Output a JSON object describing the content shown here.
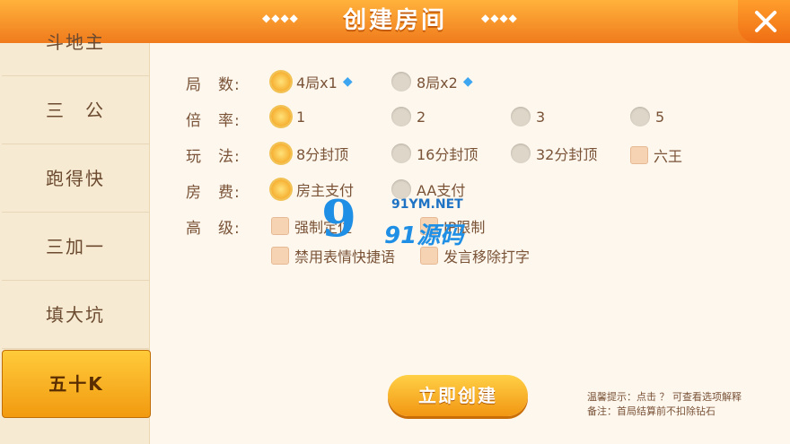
{
  "header": {
    "title": "创建房间",
    "deco": "◆◆◆◆"
  },
  "sidebar": {
    "items": [
      {
        "label": "斗地主"
      },
      {
        "label": "三　公"
      },
      {
        "label": "跑得快"
      },
      {
        "label": "三加一"
      },
      {
        "label": "填大坑"
      },
      {
        "label": "五十K"
      }
    ],
    "active": "五十K"
  },
  "rows": [
    {
      "label": "局　数:",
      "options": [
        {
          "text": "4局x1",
          "checked": true,
          "diamond": true
        },
        {
          "text": "8局x2",
          "checked": false,
          "diamond": true
        }
      ]
    },
    {
      "label": "倍　率:",
      "options": [
        {
          "text": "1",
          "checked": true
        },
        {
          "text": "2",
          "checked": false
        },
        {
          "text": "3",
          "checked": false
        },
        {
          "text": "5",
          "checked": false
        }
      ]
    },
    {
      "label": "玩　法:",
      "options": [
        {
          "text": "8分封顶",
          "checked": true
        },
        {
          "text": "16分封顶",
          "checked": false
        },
        {
          "text": "32分封顶",
          "checked": false
        },
        {
          "text": "六王",
          "checked": false
        }
      ]
    },
    {
      "label": "房　费:",
      "options": [
        {
          "text": "房主支付",
          "checked": true
        },
        {
          "text": "AA支付",
          "checked": false
        }
      ]
    },
    {
      "label": "高　级:",
      "options": [
        {
          "text": "强制定位",
          "checked": false
        },
        {
          "text": "IP限制",
          "checked": false
        },
        {
          "text": "禁用表情快捷语",
          "checked": false
        },
        {
          "text": "发言移除打字",
          "checked": false
        }
      ]
    }
  ],
  "create_label": "立即创建",
  "tips": {
    "line1": "温馨提示：点击 ？ 可查看选项解释",
    "line2": "备注：首局结算前不扣除钻石"
  },
  "watermark": {
    "logo": "9",
    "url": "91YM.NET",
    "cn": "91源码"
  },
  "colors": {
    "accent": "#f29a12",
    "text": "#7a5337"
  }
}
